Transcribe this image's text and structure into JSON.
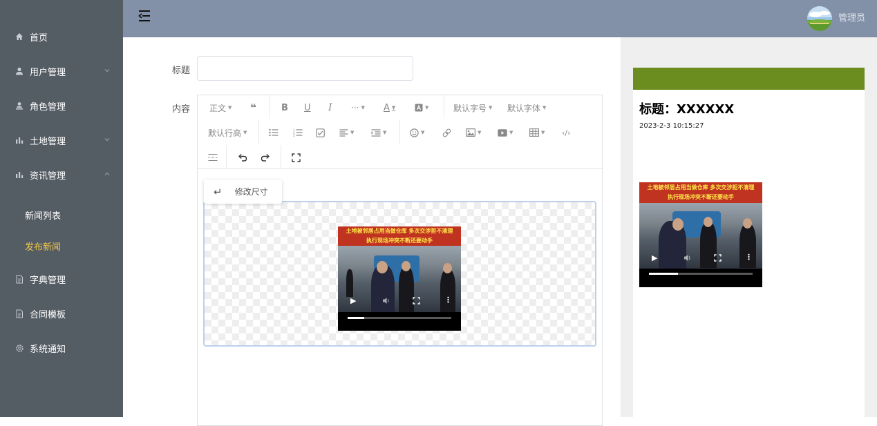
{
  "sidebar": {
    "items": [
      {
        "label": "首页",
        "icon": "home-icon"
      },
      {
        "label": "用户管理",
        "icon": "user-icon",
        "arrow": "chevron-down-icon"
      },
      {
        "label": "角色管理",
        "icon": "role-icon"
      },
      {
        "label": "土地管理",
        "icon": "bar-chart-icon",
        "arrow": "chevron-down-icon"
      },
      {
        "label": "资讯管理",
        "icon": "bar-chart-icon",
        "arrow": "chevron-up-icon"
      },
      {
        "label": "字典管理",
        "icon": "document-icon"
      },
      {
        "label": "合同模板",
        "icon": "document-icon"
      },
      {
        "label": "系统通知",
        "icon": "gear-icon"
      }
    ],
    "sub_items": [
      {
        "label": "新闻列表",
        "active": false
      },
      {
        "label": "发布新闻",
        "active": true
      }
    ],
    "active_color": "#f2c84b",
    "background": "#545c64"
  },
  "header": {
    "admin_name": "管理员",
    "background": "#8391a8"
  },
  "form": {
    "title_label": "标题",
    "title_value": "",
    "content_label": "内容"
  },
  "toolbar": {
    "paragraph": "正文",
    "font_size": "默认字号",
    "font_family": "默认字体",
    "line_height": "默认行高",
    "more": "···"
  },
  "editor": {
    "resize_label": "修改尺寸",
    "video_caption_line1": "土地被邻居占用当做仓库 多次交涉拒不清理",
    "video_caption_line2": "执行现场冲突不断还要动手"
  },
  "preview": {
    "title": "标题：XXXXXX",
    "date": "2023-2-3 10:15:27",
    "band_color": "#6b8c1e"
  }
}
